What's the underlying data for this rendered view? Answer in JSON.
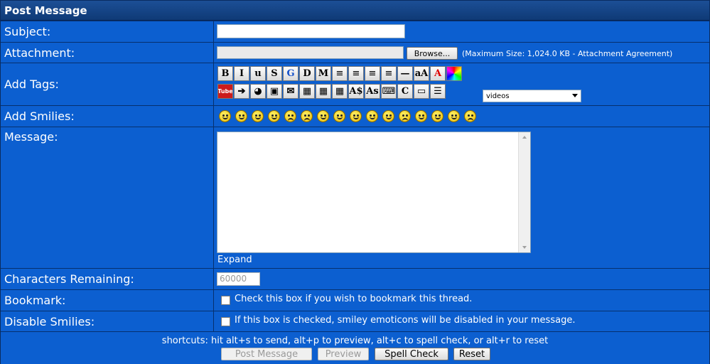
{
  "header": {
    "title": "Post Message"
  },
  "subject": {
    "label": "Subject:",
    "value": ""
  },
  "attachment": {
    "label": "Attachment:",
    "browse": "Browse...",
    "note": "(Maximum Size: 1,024.0 KB - Attachment Agreement)"
  },
  "tags": {
    "label": "Add Tags:",
    "row1": [
      "bold-icon",
      "italic-icon",
      "underline-icon",
      "strikethrough-icon",
      "glow-icon",
      "shadow-icon",
      "marquee-icon",
      "align-left-icon",
      "align-justify-icon",
      "align-center-icon",
      "align-right-icon",
      "horizontal-rule-icon",
      "font-size-icon",
      "font-color-icon",
      "color-wheel-icon"
    ],
    "row1_glyphs": [
      "B",
      "I",
      "u",
      "S",
      "G",
      "D",
      "M",
      "≡",
      "≡",
      "≡",
      "≡",
      "—",
      "aA",
      "A",
      "◉"
    ],
    "row2": [
      "youtube-icon",
      "arrow-icon",
      "globe-link-icon",
      "image-icon",
      "email-icon",
      "table-icon",
      "table-row-icon",
      "table-cell-icon",
      "superscript-icon",
      "subscript-icon",
      "typewriter-icon",
      "copyright-icon",
      "quote-icon",
      "list-icon"
    ],
    "row2_glyphs": [
      "Tube",
      "➔",
      "◕",
      "▣",
      "✉",
      "▦",
      "▦",
      "▦",
      "A$",
      "As",
      "⌨",
      "C",
      "▭",
      "☰"
    ],
    "dropdown": "videos"
  },
  "smilies": {
    "label": "Add Smilies:",
    "count": 16
  },
  "message": {
    "label": "Message:",
    "value": "",
    "expand": "Expand"
  },
  "chars": {
    "label": "Characters Remaining:",
    "value": "60000"
  },
  "bookmark": {
    "label": "Bookmark:",
    "text": "Check this box if you wish to bookmark this thread."
  },
  "disable_smilies": {
    "label": "Disable Smilies:",
    "text": "If this box is checked, smiley emoticons will be disabled in your message."
  },
  "footer": {
    "shortcuts": "shortcuts: hit alt+s to send, alt+p to preview, alt+c to spell check, or alt+r to reset",
    "post": "Post Message",
    "preview": "Preview",
    "spell": "Spell Check",
    "reset": "Reset"
  },
  "colors": {
    "row_bg": "#0c5fd0",
    "header_bg": "#0f3a76",
    "border": "#06306e"
  }
}
